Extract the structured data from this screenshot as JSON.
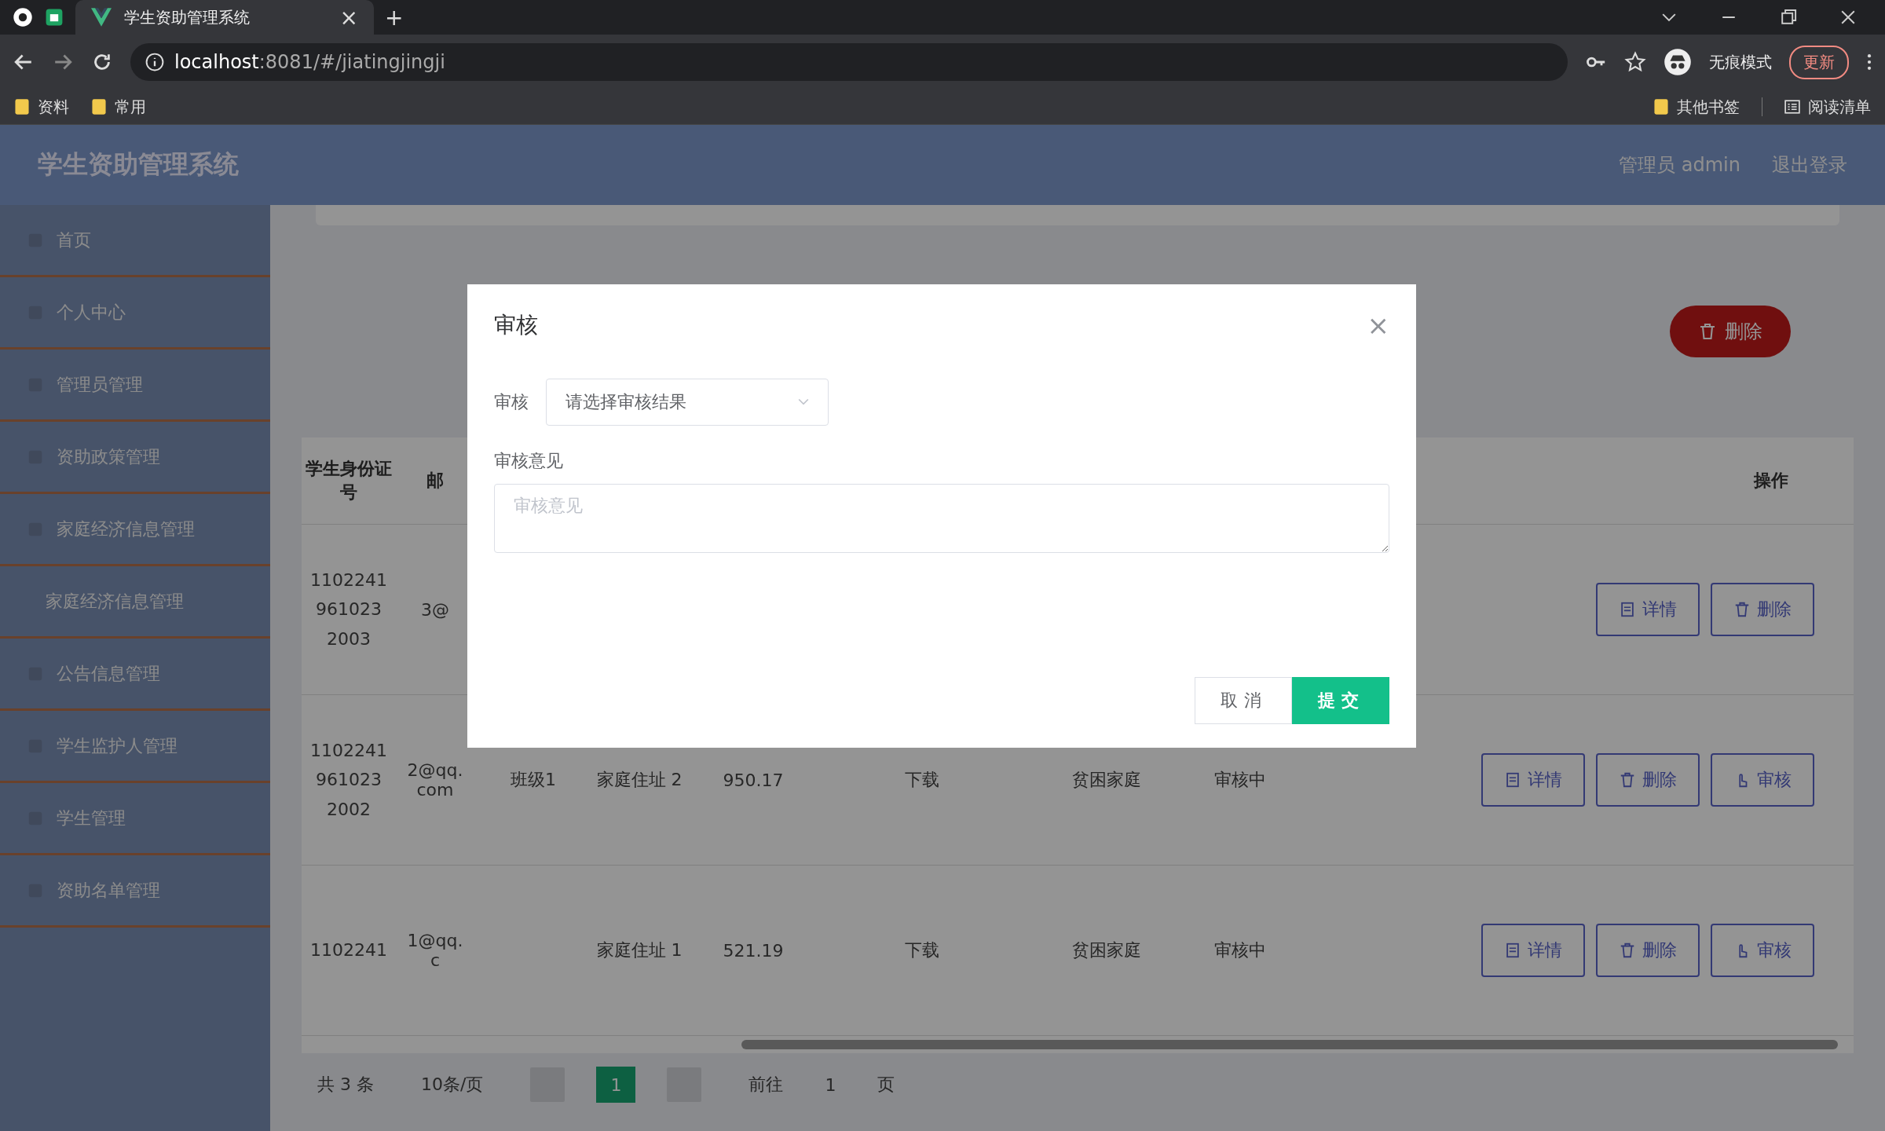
{
  "browser": {
    "tab_title": "学生资助管理系统",
    "tab_close": "×",
    "new_tab": "+",
    "url_host": "localhost",
    "url_rest": ":8081/#/jiatingjingji",
    "incognito": "无痕模式",
    "update": "更新",
    "bookmarks": [
      "资料",
      "常用"
    ],
    "bookmarks_right": [
      "其他书签",
      "阅读清单"
    ]
  },
  "app": {
    "title": "学生资助管理系统",
    "user": "管理员 admin",
    "logout": "退出登录"
  },
  "sidebar": {
    "items": [
      {
        "label": "首页"
      },
      {
        "label": "个人中心"
      },
      {
        "label": "管理员管理"
      },
      {
        "label": "资助政策管理"
      },
      {
        "label": "家庭经济信息管理",
        "children": [
          {
            "label": "家庭经济信息管理"
          }
        ]
      },
      {
        "label": "公告信息管理"
      },
      {
        "label": "学生监护人管理"
      },
      {
        "label": "学生管理"
      },
      {
        "label": "资助名单管理"
      }
    ]
  },
  "toolbar": {
    "delete_button": "删除"
  },
  "table": {
    "columns": [
      "学生身份证号",
      "邮"
    ],
    "ops_column": "操作",
    "rows": [
      {
        "id": "1102241 961023 2003",
        "email": "3@",
        "actions": [
          {
            "kind": "detail",
            "label": "详情"
          },
          {
            "kind": "delete",
            "label": "删除"
          }
        ]
      },
      {
        "id": "1102241 961023 2002",
        "email": "2@qq.com",
        "class_name": "班级1",
        "address": "家庭住址 2",
        "amount": "950.17",
        "file": "下载",
        "family_type": "贫困家庭",
        "status": "审核中",
        "actions": [
          {
            "kind": "detail",
            "label": "详情"
          },
          {
            "kind": "delete",
            "label": "删除"
          },
          {
            "kind": "review",
            "label": "审核"
          }
        ]
      },
      {
        "id": "1102241",
        "email": "1@qq.c",
        "address": "家庭住址 1",
        "amount": "521.19",
        "file": "下载",
        "family_type": "贫困家庭",
        "status": "审核中",
        "actions": [
          {
            "kind": "detail",
            "label": "详情"
          },
          {
            "kind": "delete",
            "label": "删除"
          },
          {
            "kind": "review",
            "label": "审核"
          }
        ]
      }
    ]
  },
  "pagination": {
    "total": "共 3 条",
    "page_size": "10条/页",
    "pages": [
      {
        "label": "1",
        "selected": true
      }
    ],
    "goto": "前往",
    "goto_value": "1",
    "page_unit": "页"
  },
  "dialog": {
    "title": "审核",
    "close": "×",
    "fields": [
      {
        "kind": "select",
        "label": "审核",
        "placeholder": "请选择审核结果"
      },
      {
        "kind": "textarea",
        "label": "审核意见",
        "placeholder": "审核意见"
      }
    ],
    "buttons": [
      {
        "kind": "cancel",
        "label": "取消"
      },
      {
        "kind": "submit",
        "label": "提交"
      }
    ]
  }
}
